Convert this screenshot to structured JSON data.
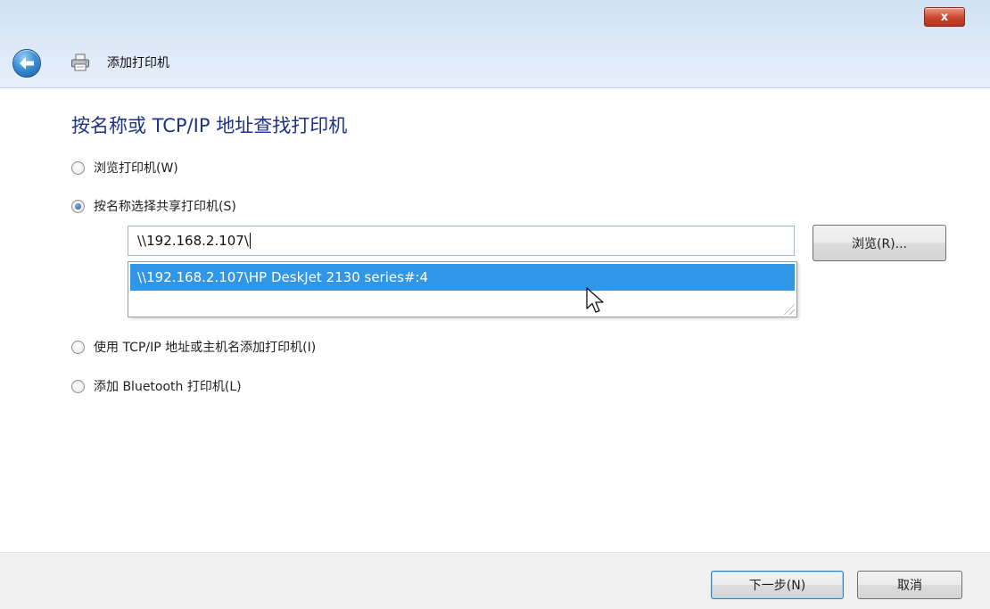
{
  "window": {
    "title": "添加打印机",
    "close_label": "x"
  },
  "content": {
    "heading": "按名称或 TCP/IP 地址查找打印机",
    "options": [
      {
        "label": "浏览打印机(W)",
        "checked": false
      },
      {
        "label": "按名称选择共享打印机(S)",
        "checked": true
      },
      {
        "label": "使用 TCP/IP 地址或主机名添加打印机(I)",
        "checked": false
      },
      {
        "label": "添加 Bluetooth 打印机(L)",
        "checked": false
      }
    ],
    "share_input_value": "\\\\192.168.2.107\\",
    "browse_label": "浏览(R)...",
    "suggestion": "\\\\192.168.2.107\\HP DeskJet 2130 series#:4"
  },
  "footer": {
    "next_label": "下一步(N)",
    "cancel_label": "取消"
  },
  "colors": {
    "heading": "#1e3287",
    "selection": "#3296e6",
    "close_button": "#c9452c"
  },
  "icons": [
    "back-arrow-icon",
    "printer-icon",
    "close-icon",
    "mouse-cursor-icon",
    "resize-grip-icon"
  ]
}
